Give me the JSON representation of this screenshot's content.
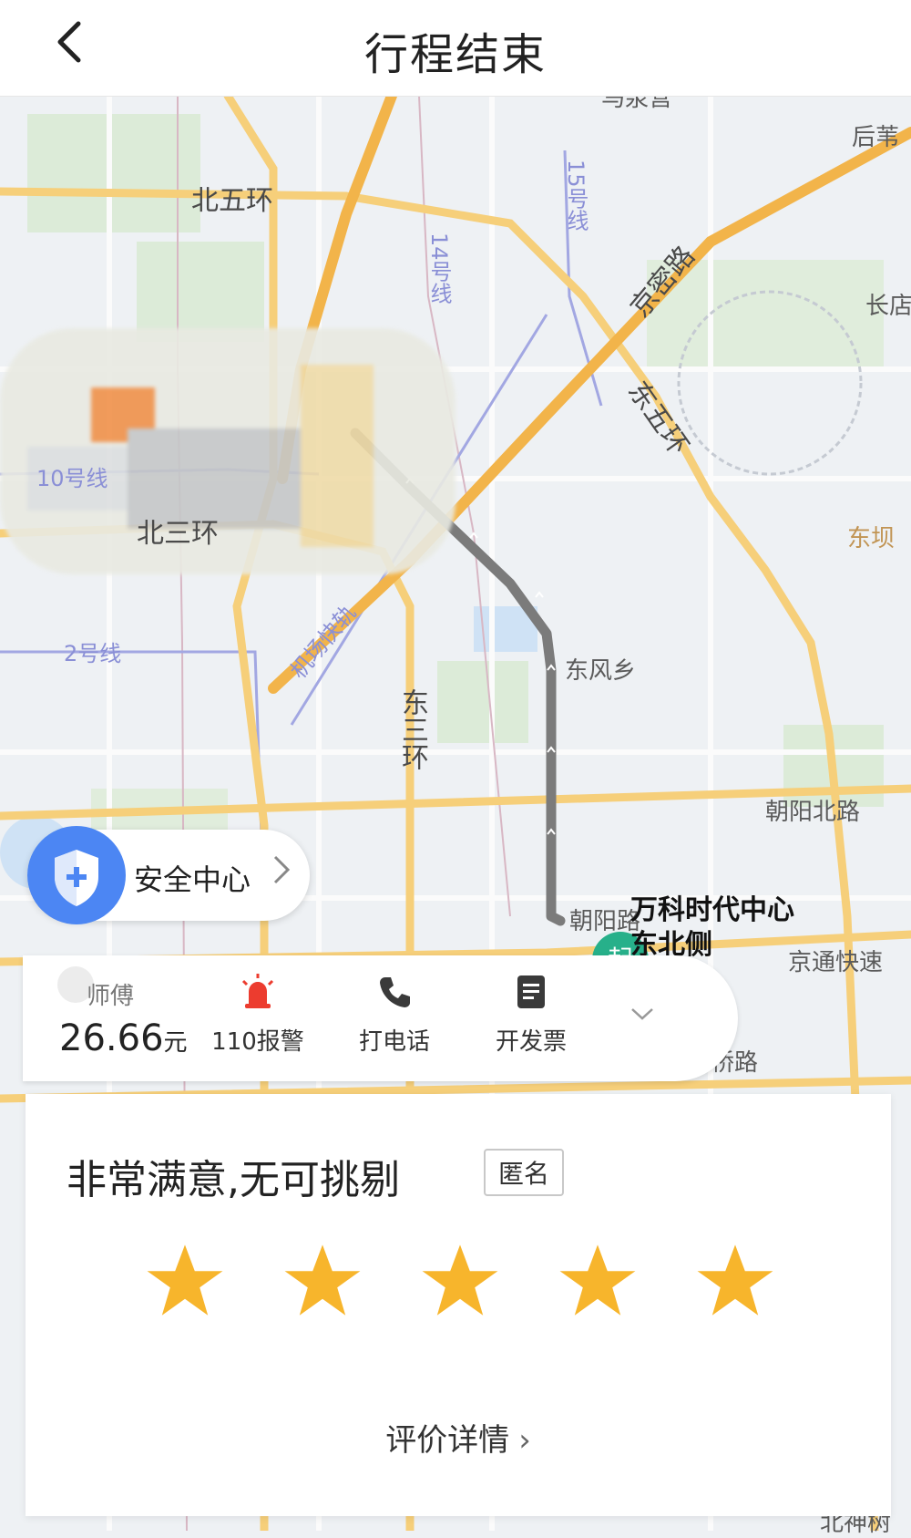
{
  "header": {
    "title": "行程结束",
    "back_icon": "chevron-left-icon"
  },
  "map": {
    "labels": {
      "beiwuhuan": "北五环",
      "beisanhuan": "北三环",
      "dongwuhuan": "东五环",
      "dongsanhuan": "东三环",
      "jingmilu": "京密路",
      "jichangkuaisu": "机场快轨",
      "line10": "10号线",
      "line2": "2号线",
      "line14": "14号线",
      "line15": "15号线",
      "dongfengxiang": "东风乡",
      "dongba": "东坝",
      "houweijie": "后苇",
      "changdian": "长店",
      "chaoyangbeilu": "朝阳北路",
      "jingtongkuaisu": "京通快速",
      "chaoyanglu": "朝阳路",
      "qiaolu": "桥路",
      "beishenshu": "北神树",
      "top_cut": "马泉营"
    },
    "start_marker": "起",
    "destination_line1": "万科时代中心",
    "destination_line2": "东北侧"
  },
  "safety": {
    "label": "安全中心",
    "icon": "shield-plus-icon",
    "arrow_icon": "chevron-right-icon"
  },
  "driver": {
    "name": "师傅",
    "fare_amount": "26.66",
    "fare_unit": "元",
    "actions": [
      {
        "label": "110报警",
        "icon": "alarm-light-icon"
      },
      {
        "label": "打电话",
        "icon": "phone-icon"
      },
      {
        "label": "开发票",
        "icon": "invoice-icon"
      }
    ],
    "expand_icon": "chevron-down-icon"
  },
  "rating": {
    "text": "非常满意,无可挑剔",
    "anonymous_tag": "匿名",
    "stars": 5,
    "max_stars": 5,
    "star_color": "#f7b52c",
    "details_link": "评价详情"
  },
  "colors": {
    "route": "#7b7b7b",
    "marker": "#27b08a",
    "safety_blue": "#4c86f3"
  }
}
